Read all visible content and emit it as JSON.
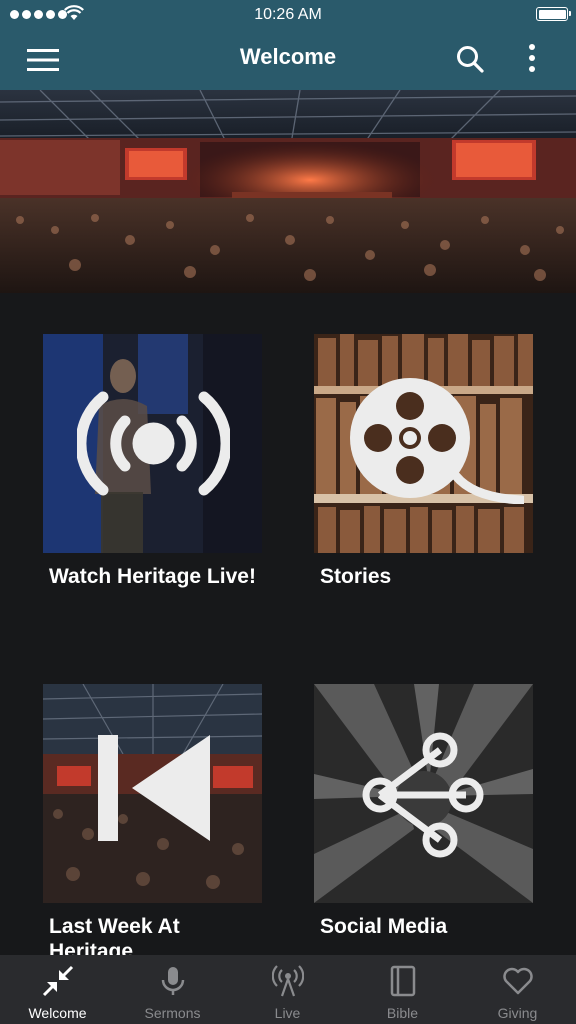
{
  "status_bar": {
    "time": "10:26 AM"
  },
  "header": {
    "title": "Welcome"
  },
  "tiles": [
    {
      "label": "Watch Heritage Live!",
      "icon": "broadcast-icon"
    },
    {
      "label": "Stories",
      "icon": "film-reel-icon"
    },
    {
      "label": "Last Week At Heritage",
      "icon": "skip-back-icon"
    },
    {
      "label": "Social Media",
      "icon": "share-icon"
    }
  ],
  "tabs": [
    {
      "label": "Welcome",
      "icon": "collapse-arrows-icon",
      "active": true
    },
    {
      "label": "Sermons",
      "icon": "microphone-icon",
      "active": false
    },
    {
      "label": "Live",
      "icon": "antenna-icon",
      "active": false
    },
    {
      "label": "Bible",
      "icon": "book-icon",
      "active": false
    },
    {
      "label": "Giving",
      "icon": "heart-icon",
      "active": false
    }
  ],
  "colors": {
    "header": "#2a5a6b",
    "background": "#17181a",
    "tabbar": "#2a2b2e",
    "tab_inactive": "#8a8b8e",
    "tab_active": "#ffffff"
  }
}
